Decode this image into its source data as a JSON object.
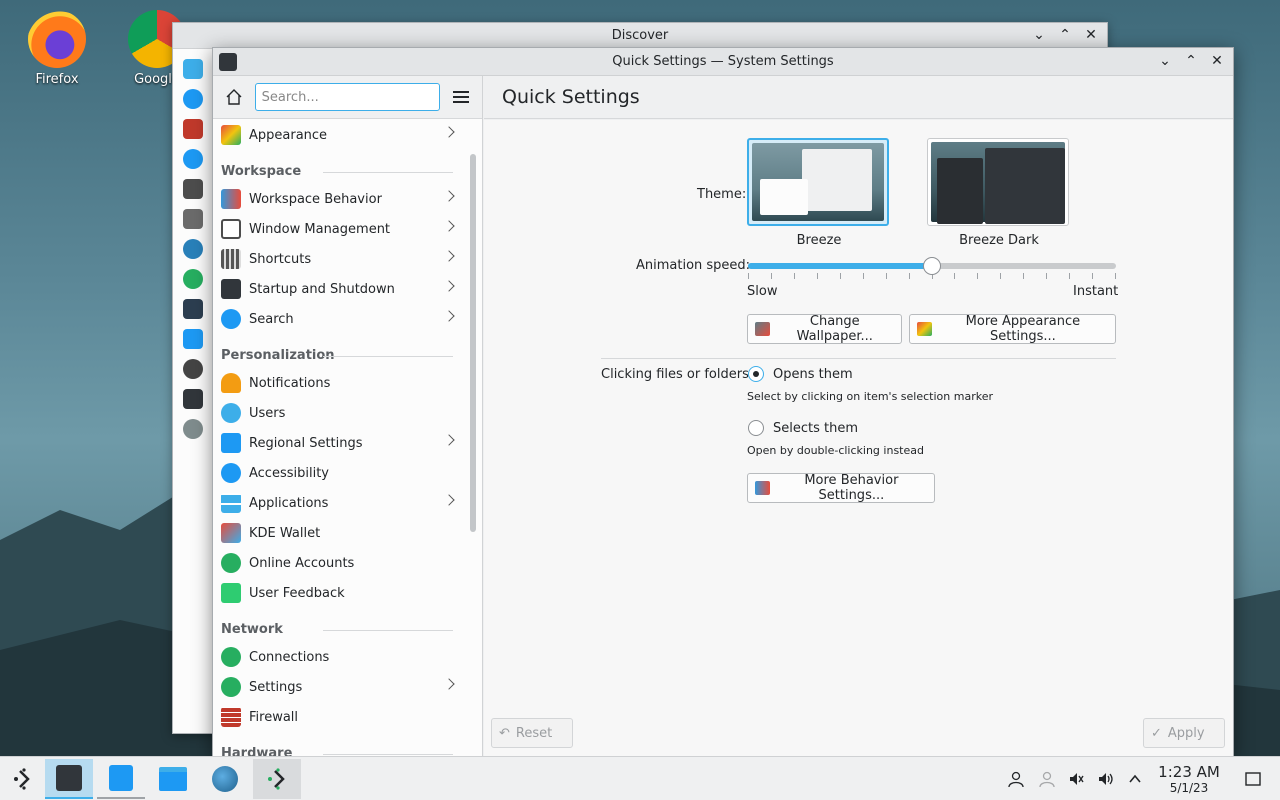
{
  "desktop": {
    "icons": [
      {
        "label": "Firefox"
      },
      {
        "label": "Google"
      }
    ]
  },
  "discover": {
    "title": "Discover"
  },
  "settings": {
    "title": "Quick Settings — System Settings",
    "search_placeholder": "Search...",
    "page_title": "Quick Settings",
    "sidebar": {
      "appearance": "Appearance",
      "sections": {
        "workspace": "Workspace",
        "personalization": "Personalization",
        "network": "Network",
        "hardware": "Hardware"
      },
      "workspace_items": [
        "Workspace Behavior",
        "Window Management",
        "Shortcuts",
        "Startup and Shutdown",
        "Search"
      ],
      "personalization_items": [
        "Notifications",
        "Users",
        "Regional Settings",
        "Accessibility",
        "Applications",
        "KDE Wallet",
        "Online Accounts",
        "User Feedback"
      ],
      "network_items": [
        "Connections",
        "Settings",
        "Firewall"
      ]
    },
    "theme": {
      "label": "Theme:",
      "options": [
        "Breeze",
        "Breeze Dark"
      ],
      "selected": "Breeze"
    },
    "animation": {
      "label": "Animation speed:",
      "min_label": "Slow",
      "max_label": "Instant",
      "value": 0.5
    },
    "buttons": {
      "change_wallpaper": "Change Wallpaper...",
      "more_appearance": "More Appearance Settings...",
      "more_behavior": "More Behavior Settings...",
      "reset": "Reset",
      "apply": "Apply"
    },
    "clicking": {
      "label": "Clicking files or folders:",
      "opens": "Opens them",
      "opens_hint": "Select by clicking on item's selection marker",
      "selects": "Selects them",
      "selects_hint": "Open by double-clicking instead",
      "selected": "Opens them"
    }
  },
  "taskbar": {
    "time": "1:23 AM",
    "date": "5/1/23"
  },
  "colors": {
    "accent": "#3daee9",
    "window_bg": "#eff0f1",
    "text": "#232629"
  }
}
